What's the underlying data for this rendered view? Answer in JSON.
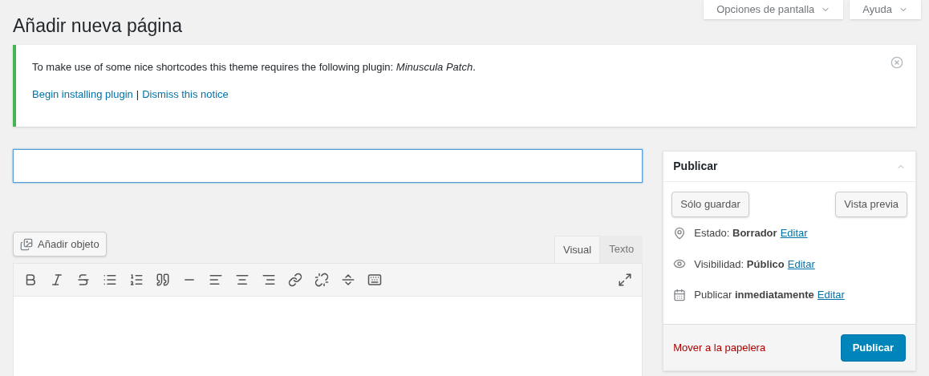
{
  "header_buttons": [
    {
      "label": "Opciones de pantalla"
    },
    {
      "label": "Ayuda"
    }
  ],
  "page_title": "Añadir nueva página",
  "notice": {
    "text": "To make use of some nice shortcodes this theme requires the following plugin: *Minuscula Patch*.",
    "links": [
      "Begin installing plugin",
      "Dismiss this notice"
    ],
    "separator": "|"
  },
  "editor": {
    "add_media": "Añadir objeto",
    "tabs": [
      {
        "label": "Visual",
        "selected": true
      },
      {
        "label": "Texto",
        "selected": false
      }
    ]
  },
  "publish_box": {
    "title": "Publicar",
    "buttons": [
      "Sólo guardar",
      "Vista previa"
    ],
    "rows": [
      {
        "kind": "status",
        "label": "Estado:",
        "value": "Borrador",
        "link": "Editar"
      },
      {
        "kind": "visibility",
        "label": "Visibilidad:",
        "value": "Público",
        "link": "Editar"
      },
      {
        "kind": "schedule",
        "label": "Publicar",
        "value": "inmediatamente",
        "link": "Editar"
      }
    ],
    "trash_link": "Mover a la papelera",
    "publish_button": "Publicar"
  }
}
